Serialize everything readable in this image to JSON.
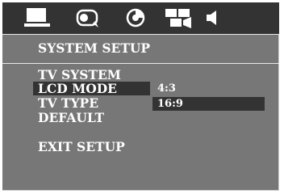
{
  "tabs": [
    {
      "id": "setup",
      "icon": "monitor-icon"
    },
    {
      "id": "language",
      "icon": "speech-bubble-icon"
    },
    {
      "id": "disc",
      "icon": "disc-icon"
    },
    {
      "id": "video",
      "icon": "video-camera-icon"
    },
    {
      "id": "audio",
      "icon": "speaker-icon"
    }
  ],
  "page": {
    "title": "SYSTEM SETUP"
  },
  "menu": {
    "items": [
      {
        "label": "TV SYSTEM"
      },
      {
        "label": "LCD MODE"
      },
      {
        "label": "TV TYPE"
      },
      {
        "label": "DEFAULT"
      },
      {
        "label": "EXIT SETUP"
      }
    ],
    "highlighted": "LCD MODE"
  },
  "options": {
    "items": [
      {
        "label": "4:3"
      },
      {
        "label": "16:9"
      }
    ],
    "selected": "16:9"
  },
  "colors": {
    "panel_background": "#777777",
    "highlight": "#333333",
    "text": "#ffffff",
    "rule": "#e8e8e8"
  }
}
